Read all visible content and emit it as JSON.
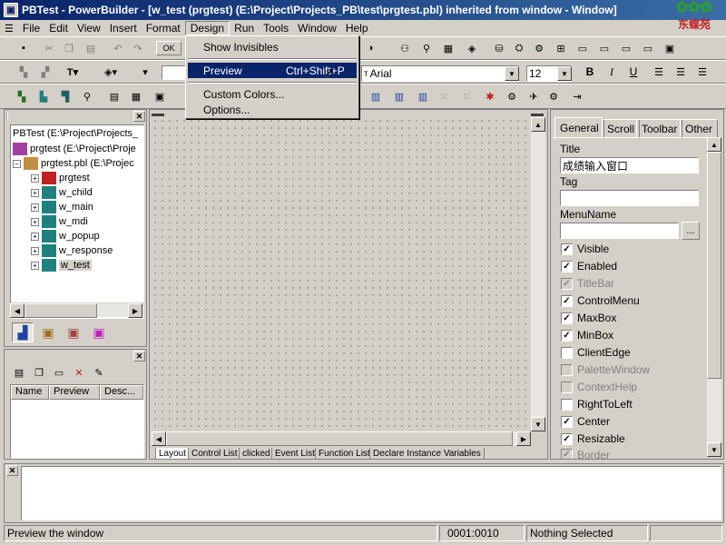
{
  "window": {
    "title": "PBTest - PowerBuilder - [w_test (prgtest) (E:\\Project\\Projects_PB\\test\\prgtest.pbl) inherited from window - Window]",
    "logo_text": "东蝶苑"
  },
  "menubar": {
    "items": [
      "File",
      "Edit",
      "View",
      "Insert",
      "Format",
      "Design",
      "Run",
      "Tools",
      "Window",
      "Help"
    ],
    "active": "Design"
  },
  "design_menu": {
    "items": [
      {
        "label": "Show Invisibles",
        "shortcut": ""
      },
      {
        "label": "Preview",
        "shortcut": "Ctrl+Shift+P"
      },
      {
        "label": "Custom Colors...",
        "shortcut": ""
      },
      {
        "label": "Options...",
        "shortcut": ""
      }
    ],
    "selected": "Preview"
  },
  "toolbar": {
    "ok_label": "OK",
    "font_name": "Arial",
    "font_size": "12",
    "bold": "B",
    "italic": "I",
    "underline": "U"
  },
  "tree": {
    "items": [
      {
        "label": "PBTest (E:\\Project\\Projects_",
        "level": 0
      },
      {
        "label": "prgtest (E:\\Project\\Proje",
        "level": 0
      },
      {
        "label": "prgtest.pbl (E:\\Projec",
        "level": 1
      },
      {
        "label": "prgtest",
        "level": 2
      },
      {
        "label": "w_child",
        "level": 2
      },
      {
        "label": "w_main",
        "level": 2
      },
      {
        "label": "w_mdi",
        "level": 2
      },
      {
        "label": "w_popup",
        "level": 2
      },
      {
        "label": "w_response",
        "level": 2
      },
      {
        "label": "w_test",
        "level": 2
      }
    ],
    "selected": "w_test"
  },
  "lower_list": {
    "columns": [
      "Name",
      "Preview",
      "Desc..."
    ]
  },
  "design_tabs": [
    "Layout",
    "Control List",
    "clicked",
    "Event List",
    "Function List",
    "Declare Instance Variables"
  ],
  "properties": {
    "tabs": [
      "General",
      "Scroll",
      "Toolbar",
      "Other"
    ],
    "title_label": "Title",
    "title_value": "成绩输入窗口",
    "tag_label": "Tag",
    "tag_value": "",
    "menuname_label": "MenuName",
    "menuname_value": "",
    "browse_label": "...",
    "checkboxes": [
      {
        "label": "Visible",
        "checked": true,
        "disabled": false
      },
      {
        "label": "Enabled",
        "checked": true,
        "disabled": false
      },
      {
        "label": "TitleBar",
        "checked": true,
        "disabled": true
      },
      {
        "label": "ControlMenu",
        "checked": true,
        "disabled": false
      },
      {
        "label": "MaxBox",
        "checked": true,
        "disabled": false
      },
      {
        "label": "MinBox",
        "checked": true,
        "disabled": false
      },
      {
        "label": "ClientEdge",
        "checked": false,
        "disabled": false
      },
      {
        "label": "PaletteWindow",
        "checked": false,
        "disabled": true
      },
      {
        "label": "ContextHelp",
        "checked": false,
        "disabled": true
      },
      {
        "label": "RightToLeft",
        "checked": false,
        "disabled": false
      },
      {
        "label": "Center",
        "checked": true,
        "disabled": false
      },
      {
        "label": "Resizable",
        "checked": true,
        "disabled": false
      },
      {
        "label": "Border",
        "checked": true,
        "disabled": true
      }
    ]
  },
  "statusbar": {
    "message": "Preview the window",
    "position": "0001:0010",
    "selection": "Nothing Selected"
  }
}
